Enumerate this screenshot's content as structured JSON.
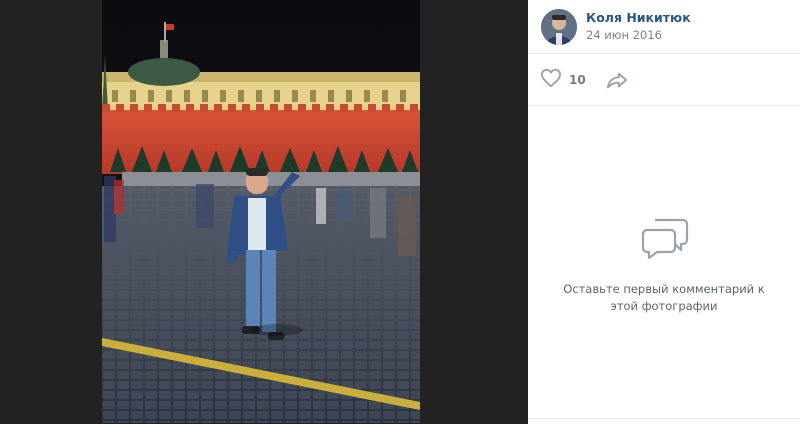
{
  "author": {
    "name": "Коля Никитюк",
    "date": "24 июн 2016",
    "avatar_icon": "user-avatar"
  },
  "actions": {
    "like_icon": "heart-outline-icon",
    "like_count": "10",
    "share_icon": "share-arrow-icon"
  },
  "comments": {
    "empty_icon": "comments-bubbles-icon",
    "empty_text": "Оставьте первый комментарий к этой фотографии"
  },
  "colors": {
    "viewer_background": "#222222",
    "link": "#2a5885",
    "muted": "#828282",
    "icon": "#99a2ad"
  }
}
